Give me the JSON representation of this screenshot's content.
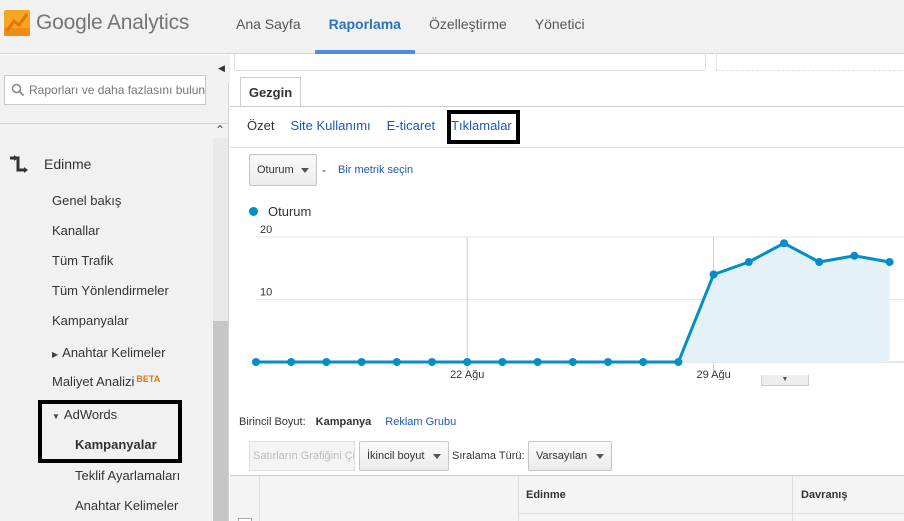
{
  "app": {
    "logo_text": "Google Analytics"
  },
  "nav": [
    "Ana Sayfa",
    "Raporlama",
    "Özelleştirme",
    "Yönetici"
  ],
  "sidebar": {
    "search_placeholder": "Raporları ve daha fazlasını bulun",
    "section": "Edinme",
    "items": [
      "Genel bakış",
      "Kanallar",
      "Tüm Trafik",
      "Tüm Yönlendirmeler",
      "Kampanyalar",
      "Anahtar Kelimeler",
      "Maliyet Analizi",
      "AdWords",
      "Kampanyalar",
      "Teklif Ayarlamaları",
      "Anahtar Kelimeler"
    ],
    "beta_badge": "BETA"
  },
  "main": {
    "tab": "Gezgin",
    "subtabs": [
      "Özet",
      "Site Kullanımı",
      "E-ticaret",
      "Tıklamalar"
    ],
    "metric_select": "Oturum",
    "dash": "-",
    "choose_metric": "Bir metrik seçin",
    "legend": "Oturum",
    "primary_dimension_label": "Birincil Boyut:",
    "primary_dimension_current": "Kampanya",
    "primary_dimension_alt": "Reklam Grubu",
    "plot_rows_button": "Satırların Grafiğini Çiz",
    "secondary_dimension": "İkincil boyut",
    "sort_type_label": "Sıralama Türü:",
    "sort_type": "Varsayılan",
    "table_groups": [
      "Edinme",
      "Davranış"
    ]
  },
  "chart_data": {
    "type": "line",
    "series": [
      {
        "name": "Oturum",
        "values": [
          0,
          0,
          0,
          0,
          0,
          0,
          0,
          0,
          0,
          0,
          0,
          0,
          0,
          14,
          16,
          19,
          16,
          17,
          16
        ]
      }
    ],
    "x_tick_labels": [
      "22 Ağu",
      "29 Ağu"
    ],
    "y_tick_labels": [
      "10",
      "20"
    ],
    "ylim": [
      0,
      20
    ],
    "grid": true,
    "color": "#058dc7",
    "fill": "#e4f1f9"
  }
}
